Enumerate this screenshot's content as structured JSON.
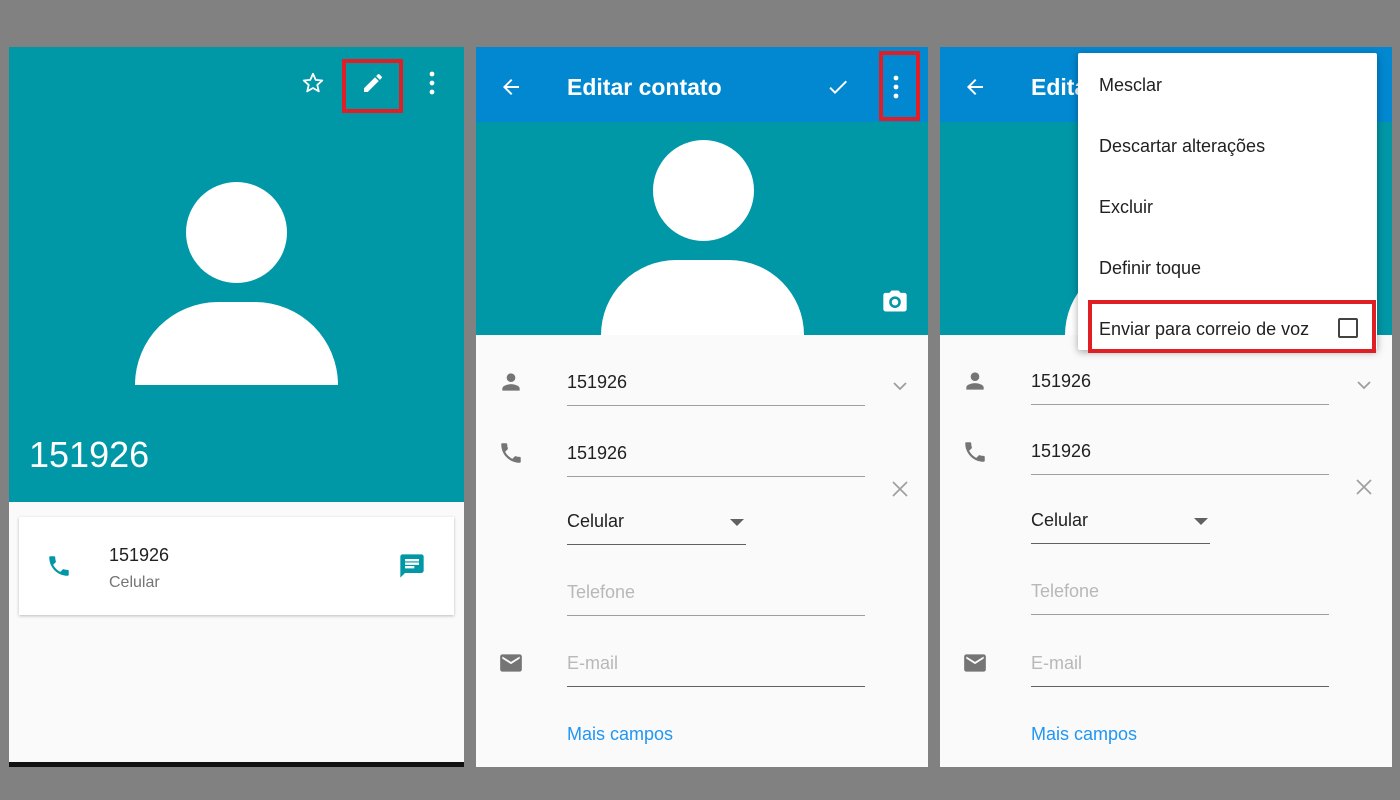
{
  "panel1": {
    "contact_name": "151926",
    "phone_number": "151926",
    "phone_type": "Celular"
  },
  "panel2": {
    "title": "Editar contato",
    "name_value": "151926",
    "phone_value": "151926",
    "phone_type": "Celular",
    "phone_placeholder": "Telefone",
    "email_placeholder": "E-mail",
    "more_fields": "Mais campos"
  },
  "panel3": {
    "title": "Edita",
    "name_value": "151926",
    "phone_value": "151926",
    "phone_type": "Celular",
    "phone_placeholder": "Telefone",
    "email_placeholder": "E-mail",
    "more_fields": "Mais campos",
    "menu": [
      "Mesclar",
      "Descartar alterações",
      "Excluir",
      "Definir toque",
      "Enviar para correio de voz"
    ]
  },
  "colors": {
    "teal": "#0097a7",
    "app_bar": "#0288d1",
    "highlight": "#e01e25",
    "link": "#2196f3"
  },
  "icons": [
    "star-outline-icon",
    "pencil-icon",
    "more-vert-icon",
    "arrow-back-icon",
    "check-icon",
    "camera-icon",
    "person-icon",
    "phone-icon",
    "email-icon",
    "message-icon",
    "close-icon",
    "chevron-down-icon",
    "dropdown-arrow-icon"
  ]
}
